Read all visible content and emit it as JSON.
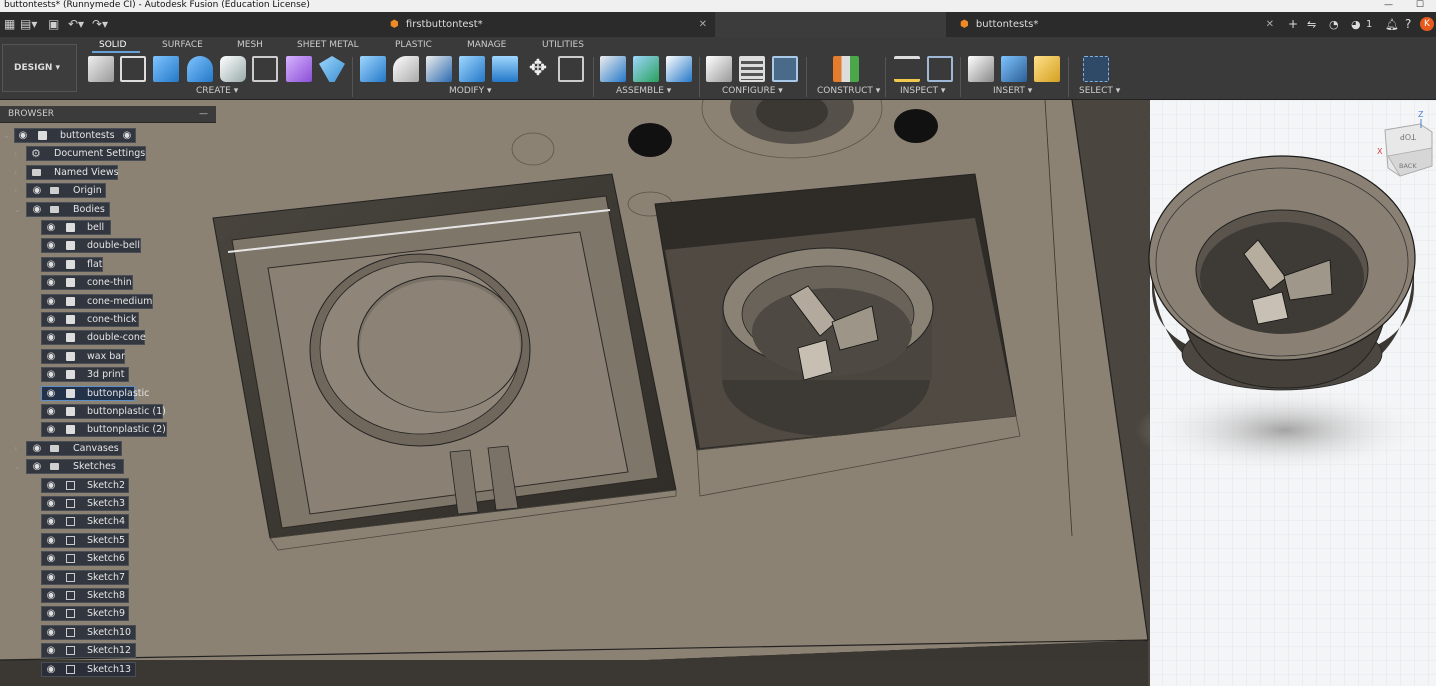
{
  "window": {
    "title": "buttontests* (Runnymede CI) - Autodesk Fusion (Education License)"
  },
  "tabs": [
    {
      "label": "firstbuttontest*"
    },
    {
      "label": "buttontests*"
    }
  ],
  "header_right": {
    "notification_count": "1"
  },
  "workspace": {
    "button": "DESIGN",
    "tabs": [
      "SOLID",
      "SURFACE",
      "MESH",
      "SHEET METAL",
      "PLASTIC",
      "MANAGE",
      "UTILITIES"
    ],
    "active_tab": "SOLID"
  },
  "toolbar_groups": [
    "CREATE",
    "MODIFY",
    "ASSEMBLE",
    "CONFIGURE",
    "CONSTRUCT",
    "INSPECT",
    "INSERT",
    "SELECT"
  ],
  "browser": {
    "title": "BROWSER",
    "root": "buttontests",
    "items": [
      {
        "label": "Document Settings",
        "kind": "settings"
      },
      {
        "label": "Named Views",
        "kind": "folder"
      },
      {
        "label": "Origin",
        "kind": "folder"
      },
      {
        "label": "Bodies",
        "kind": "folder"
      }
    ],
    "bodies": [
      "bell",
      "double-bell",
      "flat",
      "cone-thin",
      "cone-medium",
      "cone-thick",
      "double-cone",
      "wax bar",
      "3d print",
      "buttonplastic",
      "buttonplastic (1)",
      "buttonplastic (2)"
    ],
    "selected_body": "buttonplastic",
    "canvases": "Canvases",
    "sketches_folder": "Sketches",
    "sketches": [
      "Sketch2",
      "Sketch3",
      "Sketch4",
      "Sketch5",
      "Sketch6",
      "Sketch7",
      "Sketch8",
      "Sketch9",
      "Sketch10",
      "Sketch12",
      "Sketch13"
    ]
  },
  "viewcube": {
    "top": "TOP",
    "back": "BACK",
    "axis_x": "X",
    "axis_z": "Z"
  },
  "colors": {
    "accent": "#6aa0d8",
    "fusion_orange": "#f08a24",
    "model_surface": "#8c8273"
  }
}
